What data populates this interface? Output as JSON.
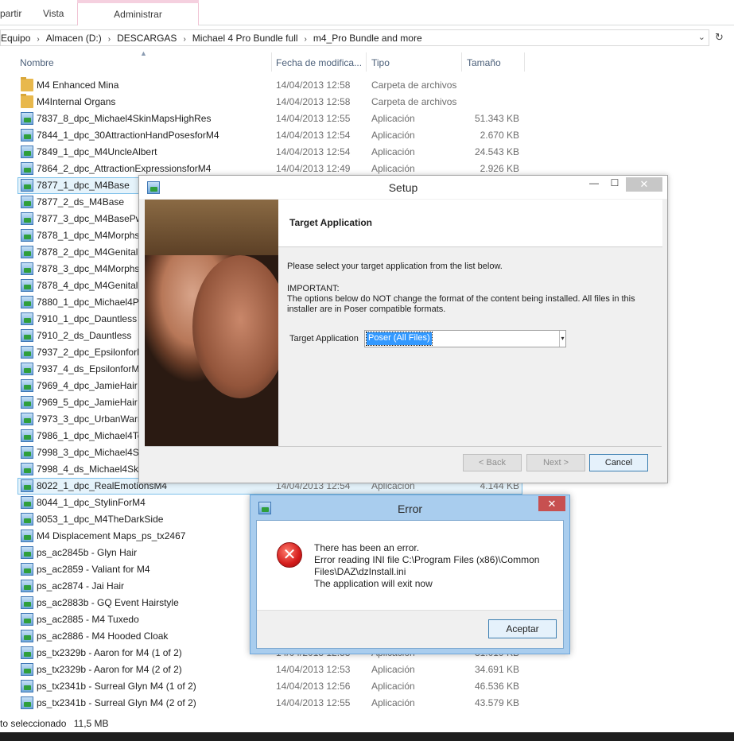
{
  "ribbon": {
    "tab_share": "partir",
    "tab_view": "Vista",
    "tab_manage": "Administrar"
  },
  "address": {
    "crumbs": [
      "Equipo",
      "Almacen (D:)",
      "DESCARGAS",
      "Michael 4 Pro Bundle full",
      "m4_Pro Bundle and more"
    ]
  },
  "columns": {
    "name": "Nombre",
    "date": "Fecha de modifica...",
    "type": "Tipo",
    "size": "Tamaño"
  },
  "files": [
    {
      "name": "M4 Enhanced Mina",
      "date": "14/04/2013 12:58",
      "type": "Carpeta de archivos",
      "size": "",
      "icon": "folder-icon"
    },
    {
      "name": "M4Internal Organs",
      "date": "14/04/2013 12:58",
      "type": "Carpeta de archivos",
      "size": "",
      "icon": "folder-icon"
    },
    {
      "name": "7837_8_dpc_Michael4SkinMapsHighRes",
      "date": "14/04/2013 12:55",
      "type": "Aplicación",
      "size": "51.343 KB",
      "icon": "app-icon"
    },
    {
      "name": "7844_1_dpc_30AttractionHandPosesforM4",
      "date": "14/04/2013 12:54",
      "type": "Aplicación",
      "size": "2.670 KB",
      "icon": "app-icon"
    },
    {
      "name": "7849_1_dpc_M4UncleAlbert",
      "date": "14/04/2013 12:54",
      "type": "Aplicación",
      "size": "24.543 KB",
      "icon": "app-icon"
    },
    {
      "name": "7864_2_dpc_AttractionExpressionsforM4",
      "date": "14/04/2013 12:49",
      "type": "Aplicación",
      "size": "2.926 KB",
      "icon": "app-icon"
    },
    {
      "name": "7877_1_dpc_M4Base",
      "date": "",
      "type": "",
      "size": "",
      "icon": "app-icon"
    },
    {
      "name": "7877_2_ds_M4Base",
      "date": "",
      "type": "",
      "size": "",
      "icon": "app-icon"
    },
    {
      "name": "7877_3_dpc_M4BasePwrl",
      "date": "",
      "type": "",
      "size": "",
      "icon": "app-icon"
    },
    {
      "name": "7878_1_dpc_M4Morphs+",
      "date": "",
      "type": "",
      "size": "",
      "icon": "app-icon"
    },
    {
      "name": "7878_2_dpc_M4Genitalia",
      "date": "",
      "type": "",
      "size": "",
      "icon": "app-icon"
    },
    {
      "name": "7878_3_dpc_M4MorphsP",
      "date": "",
      "type": "",
      "size": "",
      "icon": "app-icon"
    },
    {
      "name": "7878_4_dpc_M4Genitalia",
      "date": "",
      "type": "",
      "size": "",
      "icon": "app-icon"
    },
    {
      "name": "7880_1_dpc_Michael4Pro",
      "date": "",
      "type": "",
      "size": "",
      "icon": "app-icon"
    },
    {
      "name": "7910_1_dpc_Dauntless",
      "date": "",
      "type": "",
      "size": "",
      "icon": "app-icon"
    },
    {
      "name": "7910_2_ds_Dauntless",
      "date": "",
      "type": "",
      "size": "",
      "icon": "app-icon"
    },
    {
      "name": "7937_2_dpc_EpsilonforM",
      "date": "",
      "type": "",
      "size": "",
      "icon": "app-icon"
    },
    {
      "name": "7937_4_ds_EpsilonforMic",
      "date": "",
      "type": "",
      "size": "",
      "icon": "app-icon"
    },
    {
      "name": "7969_4_dpc_JamieHair",
      "date": "",
      "type": "",
      "size": "",
      "icon": "app-icon"
    },
    {
      "name": "7969_5_dpc_JamieHair",
      "date": "",
      "type": "",
      "size": "",
      "icon": "app-icon"
    },
    {
      "name": "7973_3_dpc_UrbanWarrio",
      "date": "",
      "type": "",
      "size": "",
      "icon": "app-icon"
    },
    {
      "name": "7986_1_dpc_Michael4Tex",
      "date": "",
      "type": "",
      "size": "",
      "icon": "app-icon"
    },
    {
      "name": "7998_3_dpc_Michael4Ski",
      "date": "",
      "type": "",
      "size": "",
      "icon": "app-icon"
    },
    {
      "name": "7998_4_ds_Michael4Skin",
      "date": "",
      "type": "",
      "size": "",
      "icon": "app-icon"
    },
    {
      "name": "8022_1_dpc_RealEmotionsM4",
      "date": "14/04/2013 12:54",
      "type": "Aplicación",
      "size": "4.144 KB",
      "icon": "app-icon"
    },
    {
      "name": "8044_1_dpc_StylinForM4",
      "date": "",
      "type": "",
      "size": "",
      "icon": "app-icon"
    },
    {
      "name": "8053_1_dpc_M4TheDarkSide",
      "date": "",
      "type": "",
      "size": "",
      "icon": "app-icon"
    },
    {
      "name": "M4 Displacement Maps_ps_tx2467",
      "date": "",
      "type": "",
      "size": "",
      "icon": "app-icon"
    },
    {
      "name": "ps_ac2845b - Glyn Hair",
      "date": "",
      "type": "",
      "size": "",
      "icon": "app-icon"
    },
    {
      "name": "ps_ac2859 - Valiant for M4",
      "date": "",
      "type": "",
      "size": "",
      "icon": "app-icon"
    },
    {
      "name": "ps_ac2874 - Jai Hair",
      "date": "",
      "type": "",
      "size": "",
      "icon": "app-icon"
    },
    {
      "name": "ps_ac2883b - GQ Event Hairstyle",
      "date": "",
      "type": "",
      "size": "",
      "icon": "app-icon"
    },
    {
      "name": "ps_ac2885 - M4 Tuxedo",
      "date": "",
      "type": "",
      "size": "",
      "icon": "app-icon"
    },
    {
      "name": "ps_ac2886 - M4 Hooded Cloak",
      "date": "",
      "type": "",
      "size": "",
      "icon": "app-icon"
    },
    {
      "name": "ps_tx2329b - Aaron for M4 (1 of 2)",
      "date": "14/04/2013 12:53",
      "type": "Aplicación",
      "size": "31.019 KB",
      "icon": "app-icon"
    },
    {
      "name": "ps_tx2329b - Aaron for M4 (2 of 2)",
      "date": "14/04/2013 12:53",
      "type": "Aplicación",
      "size": "34.691 KB",
      "icon": "app-icon"
    },
    {
      "name": "ps_tx2341b - Surreal Glyn M4 (1 of 2)",
      "date": "14/04/2013 12:56",
      "type": "Aplicación",
      "size": "46.536 KB",
      "icon": "app-icon"
    },
    {
      "name": "ps_tx2341b - Surreal Glyn M4 (2 of 2)",
      "date": "14/04/2013 12:55",
      "type": "Aplicación",
      "size": "43.579 KB",
      "icon": "app-icon"
    }
  ],
  "status": {
    "selected": "to seleccionado",
    "size": "11,5 MB"
  },
  "setup_dialog": {
    "title": "Setup",
    "header": "Target Application",
    "instruction": "Please select your target application from the list below.",
    "important_label": "IMPORTANT:",
    "important_text": "The options below do NOT change the format of the content being installed.  All files in this installer are in Poser compatible formats.",
    "target_label": "Target Application",
    "target_value": "Poser (All Files)",
    "back_label": "< Back",
    "next_label": "Next >",
    "cancel_label": "Cancel"
  },
  "error_dialog": {
    "title": "Error",
    "line1": "There has been an error.",
    "line2": "Error reading INI file C:\\Program Files (x86)\\Common Files\\DAZ\\dzInstall.ini",
    "line3": "The application will exit now",
    "ok_label": "Aceptar"
  },
  "colors": {
    "selection_bg": "#e5f3fb",
    "selection_border": "#7dc0ea",
    "error_frame": "#a9cdee",
    "close_red": "#c75050"
  }
}
